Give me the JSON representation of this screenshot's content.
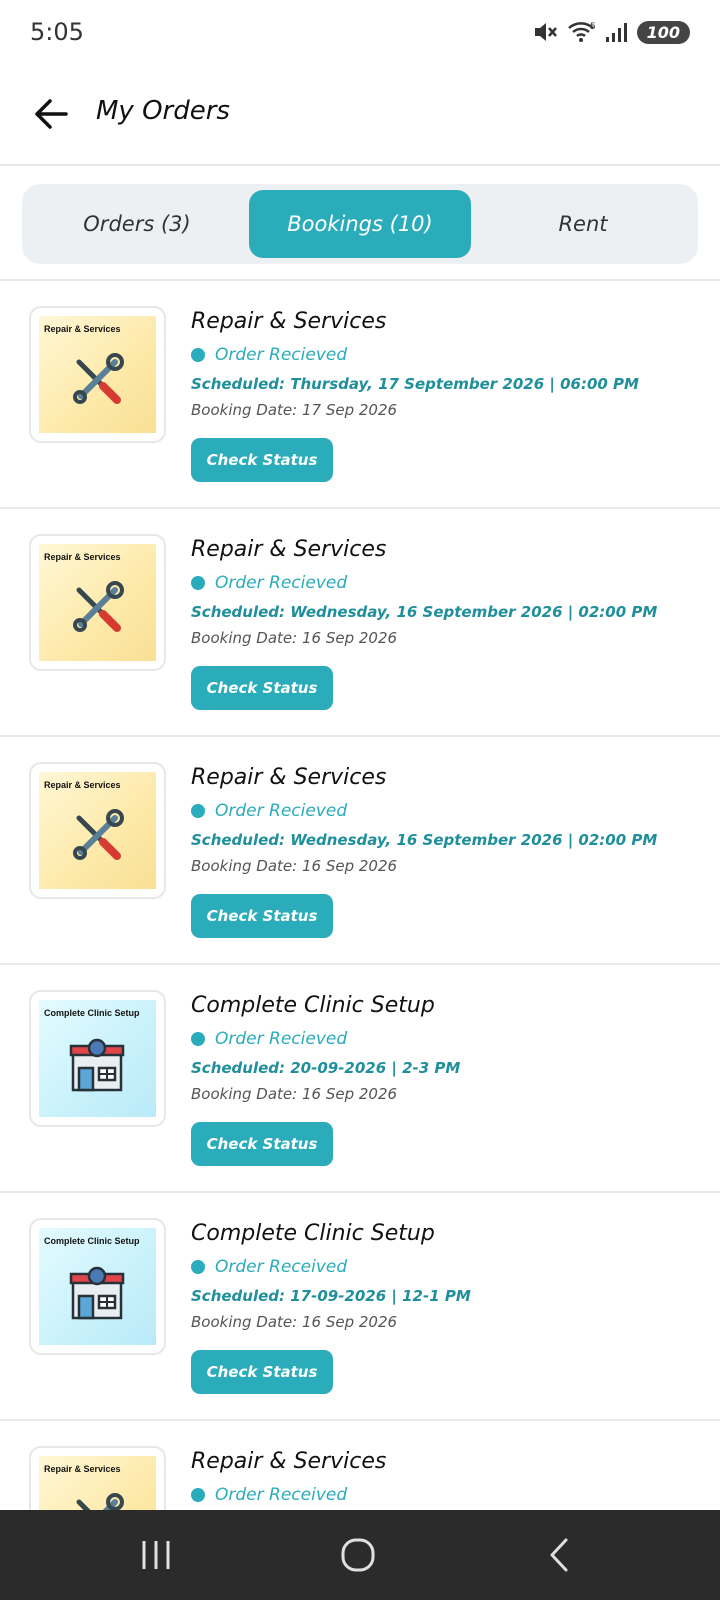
{
  "status_bar": {
    "time": "5:05",
    "battery": "100"
  },
  "header": {
    "title": "My Orders"
  },
  "tabs": [
    {
      "label": "Orders (3)",
      "active": false
    },
    {
      "label": "Bookings (10)",
      "active": true
    },
    {
      "label": "Rent",
      "active": false
    }
  ],
  "orders": [
    {
      "image_label": "Repair & Services",
      "title": "Repair & Services",
      "status": "Order Recieved",
      "scheduled": "Scheduled: Thursday, 17 September 2026 | 06:00 PM",
      "booking_date": "Booking Date: 17 Sep 2026",
      "button": "Check Status"
    },
    {
      "image_label": "Repair & Services",
      "title": "Repair & Services",
      "status": "Order Recieved",
      "scheduled": "Scheduled: Wednesday, 16 September 2026 | 02:00 PM",
      "booking_date": "Booking Date: 16 Sep 2026",
      "button": "Check Status"
    },
    {
      "image_label": "Repair & Services",
      "title": "Repair & Services",
      "status": "Order Recieved",
      "scheduled": "Scheduled: Wednesday, 16 September 2026 | 02:00 PM",
      "booking_date": "Booking Date: 16 Sep 2026",
      "button": "Check Status"
    },
    {
      "image_label": "Complete Clinic Setup",
      "title": "Complete Clinic Setup",
      "status": "Order Recieved",
      "scheduled": "Scheduled: 20-09-2026 | 2-3 PM",
      "booking_date": "Booking Date: 16 Sep 2026",
      "button": "Check Status"
    },
    {
      "image_label": "Complete Clinic Setup",
      "title": "Complete Clinic Setup",
      "status": "Order Received",
      "scheduled": "Scheduled: 17-09-2026 | 12-1 PM",
      "booking_date": "Booking Date: 16 Sep 2026",
      "button": "Check Status"
    },
    {
      "image_label": "Repair & Services",
      "title": "Repair & Services",
      "status": "Order Received"
    }
  ],
  "colors": {
    "accent": "#2aacbb",
    "divider": "#e6e8ea",
    "nav_bar": "#2b2b2b"
  },
  "icons": {
    "back": "arrow-left-icon",
    "repair": "wrench-screwdriver-icon",
    "clinic": "clinic-building-icon"
  }
}
